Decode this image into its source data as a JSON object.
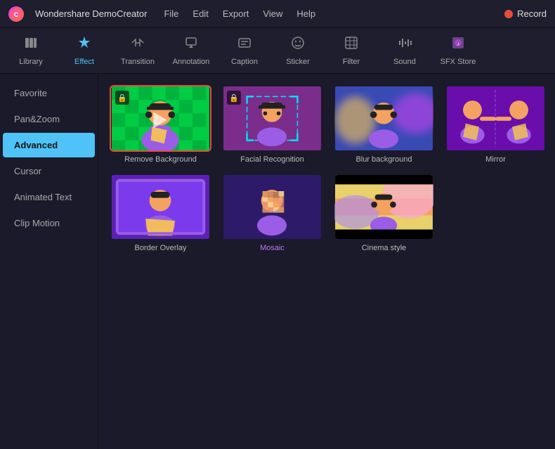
{
  "app": {
    "name": "Wondershare DemoCreator",
    "logo": "C"
  },
  "menu": {
    "items": [
      "File",
      "Edit",
      "Export",
      "View",
      "Help"
    ]
  },
  "record_button": {
    "label": "Reco..."
  },
  "toolbar": {
    "items": [
      {
        "id": "library",
        "label": "Library",
        "icon": "☰",
        "active": false
      },
      {
        "id": "effect",
        "label": "Effect",
        "icon": "✦",
        "active": true
      },
      {
        "id": "transition",
        "label": "Transition",
        "icon": "⇄",
        "active": false
      },
      {
        "id": "annotation",
        "label": "Annotation",
        "icon": "✎",
        "active": false
      },
      {
        "id": "caption",
        "label": "Caption",
        "icon": "▤",
        "active": false
      },
      {
        "id": "sticker",
        "label": "Sticker",
        "icon": "☺",
        "active": false
      },
      {
        "id": "filter",
        "label": "Filter",
        "icon": "◈",
        "active": false
      },
      {
        "id": "sound",
        "label": "Sound",
        "icon": "♬",
        "active": false
      },
      {
        "id": "sfxstore",
        "label": "SFX Store",
        "icon": "🎁",
        "active": false
      }
    ]
  },
  "sidebar": {
    "items": [
      {
        "id": "favorite",
        "label": "Favorite",
        "active": false
      },
      {
        "id": "panzoom",
        "label": "Pan&Zoom",
        "active": false
      },
      {
        "id": "advanced",
        "label": "Advanced",
        "active": true
      },
      {
        "id": "cursor",
        "label": "Cursor",
        "active": false
      },
      {
        "id": "animatedtext",
        "label": "Animated Text",
        "active": false
      },
      {
        "id": "clipmotion",
        "label": "Clip Motion",
        "active": false
      }
    ]
  },
  "effects": {
    "items": [
      {
        "id": "remove-bg",
        "label": "Remove Background",
        "selected": true,
        "locked": true,
        "color": "normal"
      },
      {
        "id": "facial-recognition",
        "label": "Facial Recognition",
        "selected": false,
        "locked": true,
        "color": "normal"
      },
      {
        "id": "blur-background",
        "label": "Blur background",
        "selected": false,
        "locked": false,
        "color": "normal"
      },
      {
        "id": "mirror",
        "label": "Mirror",
        "selected": false,
        "locked": false,
        "color": "normal"
      },
      {
        "id": "border-overlay",
        "label": "Border Overlay",
        "selected": false,
        "locked": false,
        "color": "normal"
      },
      {
        "id": "mosaic",
        "label": "Mosaic",
        "selected": false,
        "locked": false,
        "color": "purple"
      },
      {
        "id": "cinema-style",
        "label": "Cinema style",
        "selected": false,
        "locked": false,
        "color": "normal"
      }
    ]
  }
}
